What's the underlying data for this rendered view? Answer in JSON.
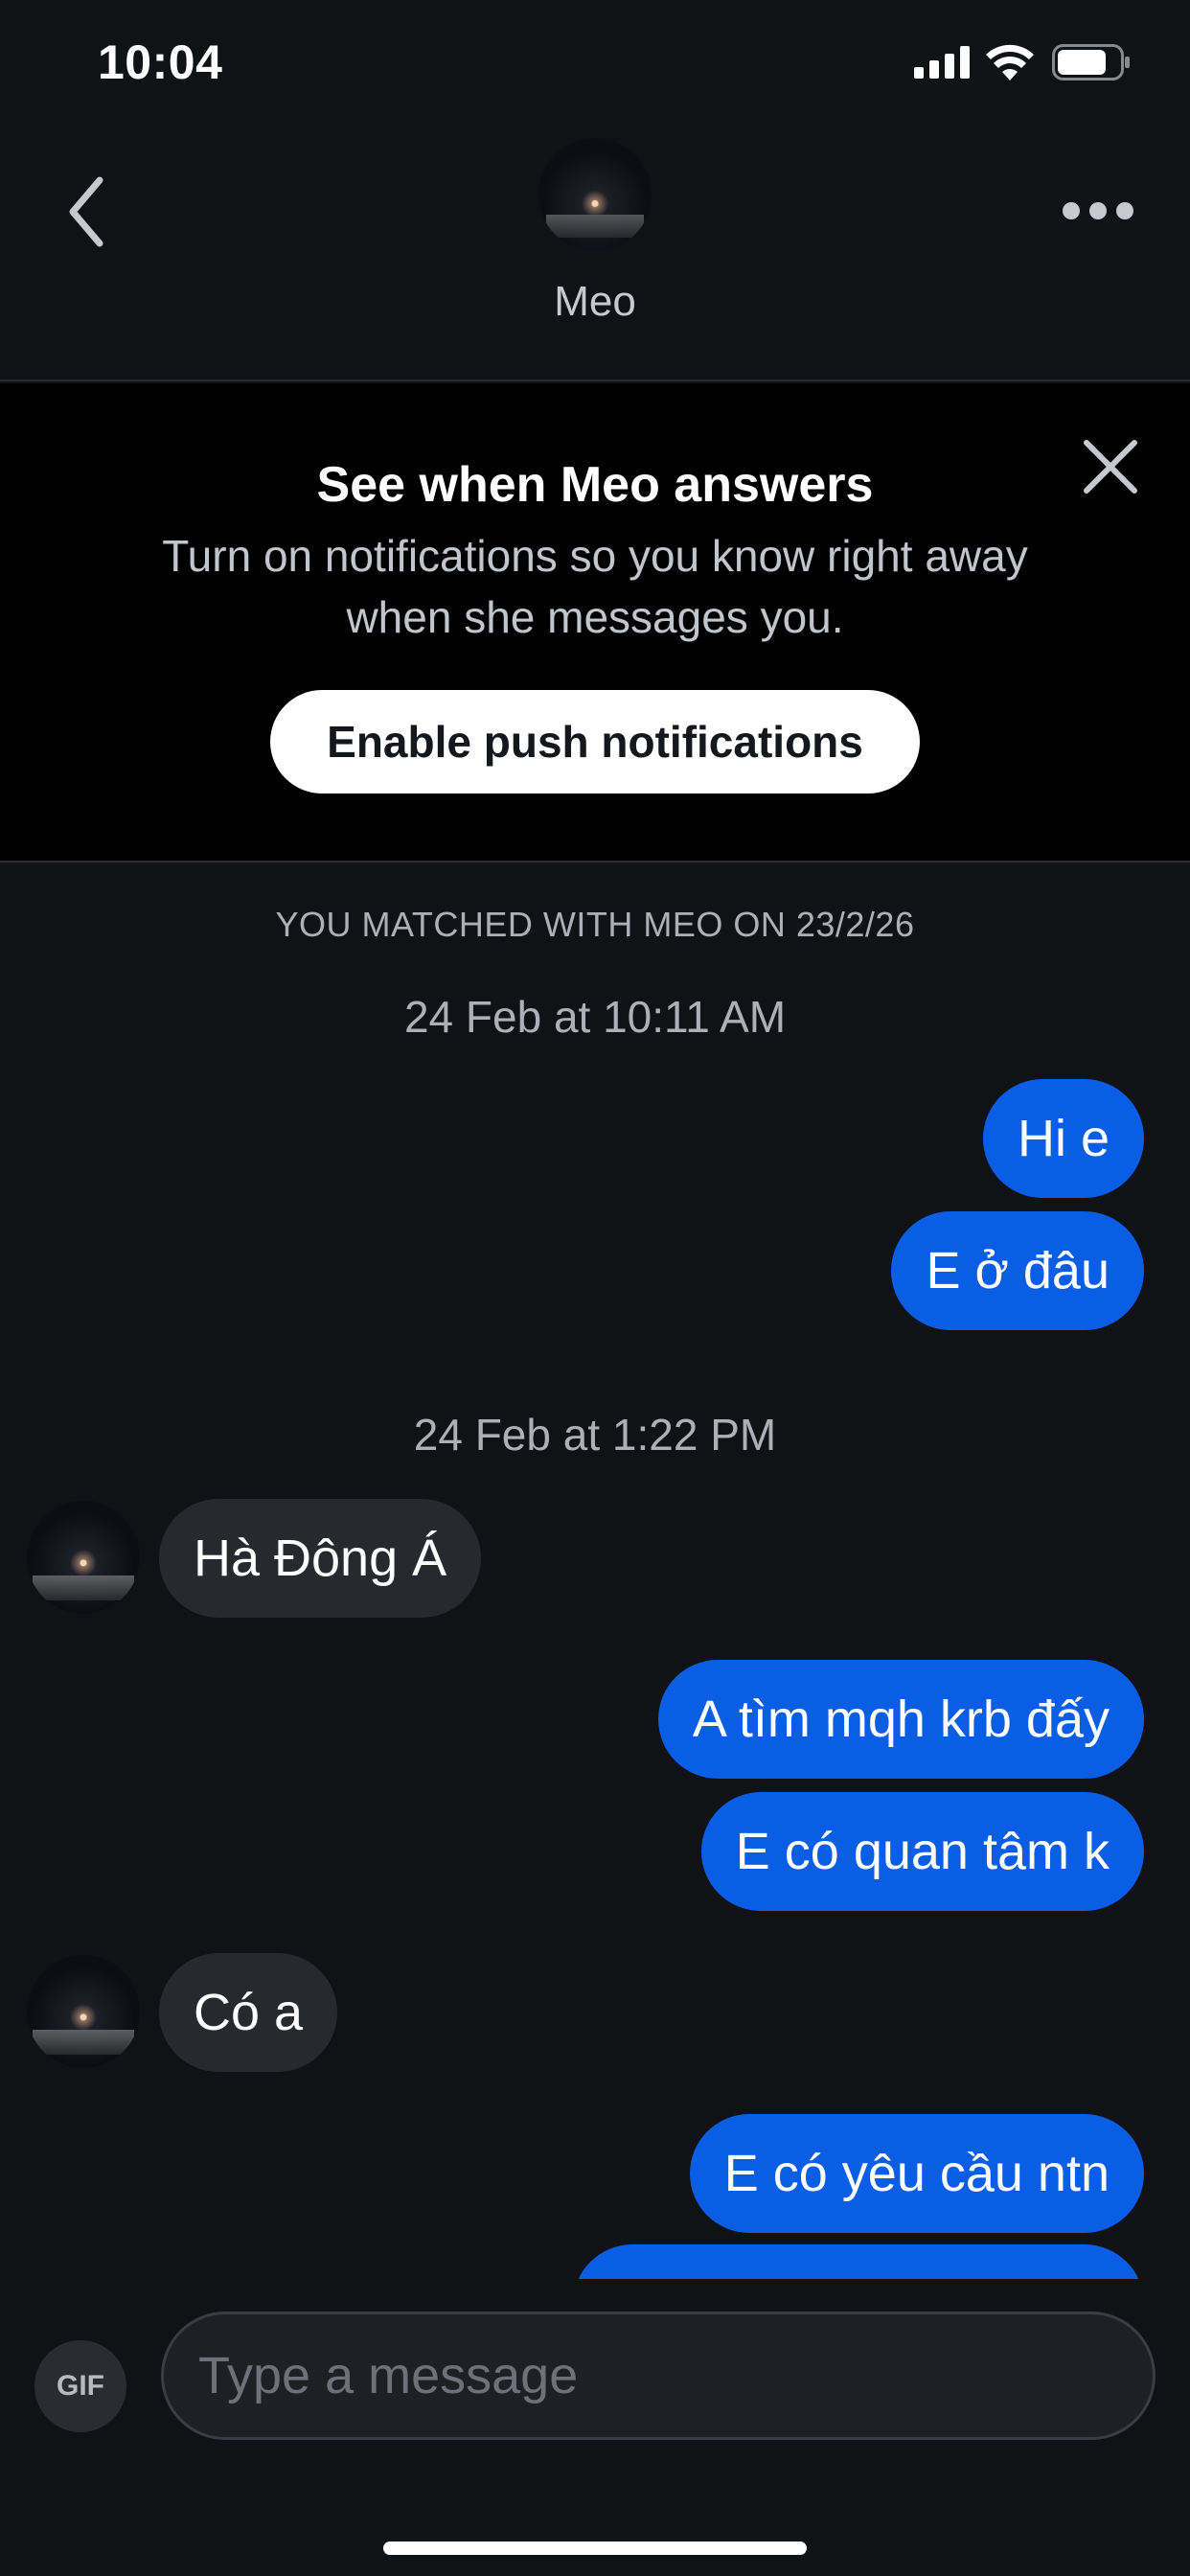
{
  "status_bar": {
    "time": "10:04"
  },
  "header": {
    "contact_name": "Meo"
  },
  "notification_banner": {
    "title": "See when Meo answers",
    "body": "Turn on notifications so you know right away when she messages you.",
    "button_label": "Enable push notifications"
  },
  "chat": {
    "matched_text": "YOU MATCHED WITH MEO ON 23/2/26",
    "timestamps": [
      "24 Feb at 10:11 AM",
      "24 Feb at 1:22 PM"
    ],
    "messages": [
      {
        "from": "me",
        "text": "Hi e"
      },
      {
        "from": "me",
        "text": "E ở đâu"
      },
      {
        "from": "them",
        "text": "Hà Đông Á"
      },
      {
        "from": "me",
        "text": "A tìm mqh krb đấy"
      },
      {
        "from": "me",
        "text": "E có quan tâm k"
      },
      {
        "from": "them",
        "text": "Có a"
      },
      {
        "from": "me",
        "text": "E có yêu cầu ntn"
      }
    ]
  },
  "composer": {
    "gif_label": "GIF",
    "placeholder": "Type a message"
  },
  "colors": {
    "sent_bubble": "#0a5ee6",
    "received_bubble": "#27292f",
    "background": "#111216"
  },
  "icons": {
    "back": "chevron-left-icon",
    "more": "more-dots-icon",
    "close": "close-icon",
    "signal": "signal-icon",
    "wifi": "wifi-icon",
    "battery": "battery-icon"
  }
}
